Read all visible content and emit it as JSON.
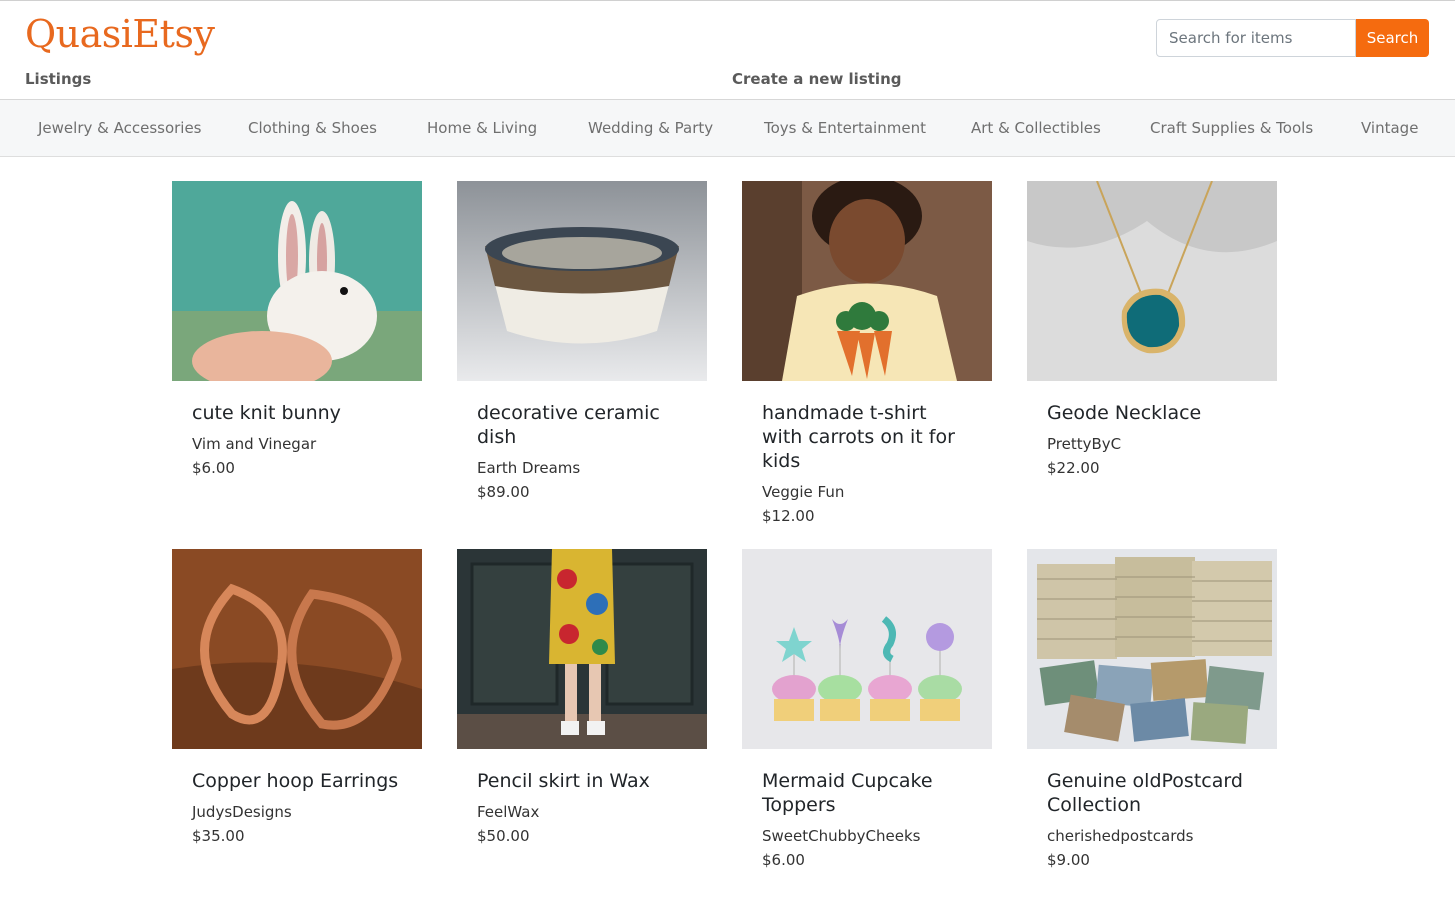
{
  "header": {
    "brand": "QuasiEtsy",
    "nav": {
      "listings": "Listings",
      "create": "Create a new listing"
    },
    "search": {
      "placeholder": "Search for items",
      "value": "",
      "button": "Search"
    }
  },
  "categories": [
    "Jewelry & Accessories",
    "Clothing & Shoes",
    "Home & Living",
    "Wedding & Party",
    "Toys & Entertainment",
    "Art & Collectibles",
    "Craft Supplies & Tools",
    "Vintage"
  ],
  "listings": [
    {
      "title": "cute knit bunny",
      "shop": "Vim and Vinegar",
      "price": "$6.00",
      "image": "knit-bunny-photo"
    },
    {
      "title": "decorative ceramic dish",
      "shop": "Earth Dreams",
      "price": "$89.00",
      "image": "ceramic-bowl-photo"
    },
    {
      "title": "handmade t-shirt with carrots on it for kids",
      "shop": "Veggie Fun",
      "price": "$12.00",
      "image": "kid-tshirt-photo"
    },
    {
      "title": "Geode Necklace",
      "shop": "PrettyByC",
      "price": "$22.00",
      "image": "geode-necklace-photo"
    },
    {
      "title": "Copper hoop Earrings",
      "shop": "JudysDesigns",
      "price": "$35.00",
      "image": "copper-earrings-photo"
    },
    {
      "title": "Pencil skirt in Wax",
      "shop": "FeelWax",
      "price": "$50.00",
      "image": "pencil-skirt-photo"
    },
    {
      "title": "Mermaid Cupcake Toppers",
      "shop": "SweetChubbyCheeks",
      "price": "$6.00",
      "image": "cupcake-toppers-photo"
    },
    {
      "title": "Genuine oldPostcard Collection",
      "shop": "cherishedpostcards",
      "price": "$9.00",
      "image": "postcards-photo"
    }
  ],
  "colors": {
    "brand": "#e8691f",
    "search_button": "#f56b0f",
    "category_bar": "#f6f7f8"
  }
}
